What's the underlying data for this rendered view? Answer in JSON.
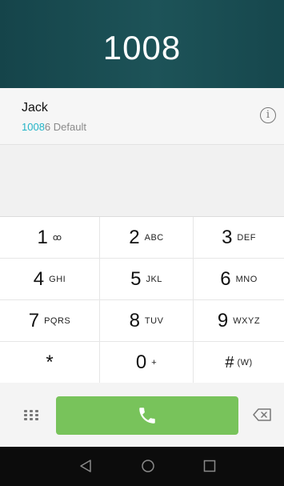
{
  "header": {
    "number": "1008"
  },
  "contact": {
    "name": "Jack",
    "number_match": "1008",
    "number_rest": "6",
    "label": " Default",
    "info_glyph": "i"
  },
  "keypad": {
    "keys": [
      {
        "digit": "1",
        "letters": "ꝏ"
      },
      {
        "digit": "2",
        "letters": "ABC"
      },
      {
        "digit": "3",
        "letters": "DEF"
      },
      {
        "digit": "4",
        "letters": "GHI"
      },
      {
        "digit": "5",
        "letters": "JKL"
      },
      {
        "digit": "6",
        "letters": "MNO"
      },
      {
        "digit": "7",
        "letters": "PQRS"
      },
      {
        "digit": "8",
        "letters": "TUV"
      },
      {
        "digit": "9",
        "letters": "WXYZ"
      },
      {
        "digit": "*",
        "letters": ""
      },
      {
        "digit": "0",
        "letters": "+"
      },
      {
        "digit": "#",
        "letters": "(W)"
      }
    ]
  },
  "colors": {
    "header_bg": "#1d5358",
    "highlight": "#23b4c7",
    "call_button": "#78c35b",
    "navbar": "#0c0c0c"
  },
  "icons": {
    "dialpad": "dialpad-grid-icon",
    "call": "phone-icon",
    "backspace": "backspace-icon",
    "nav_back": "triangle-back-icon",
    "nav_home": "circle-home-icon",
    "nav_recents": "square-recents-icon"
  }
}
